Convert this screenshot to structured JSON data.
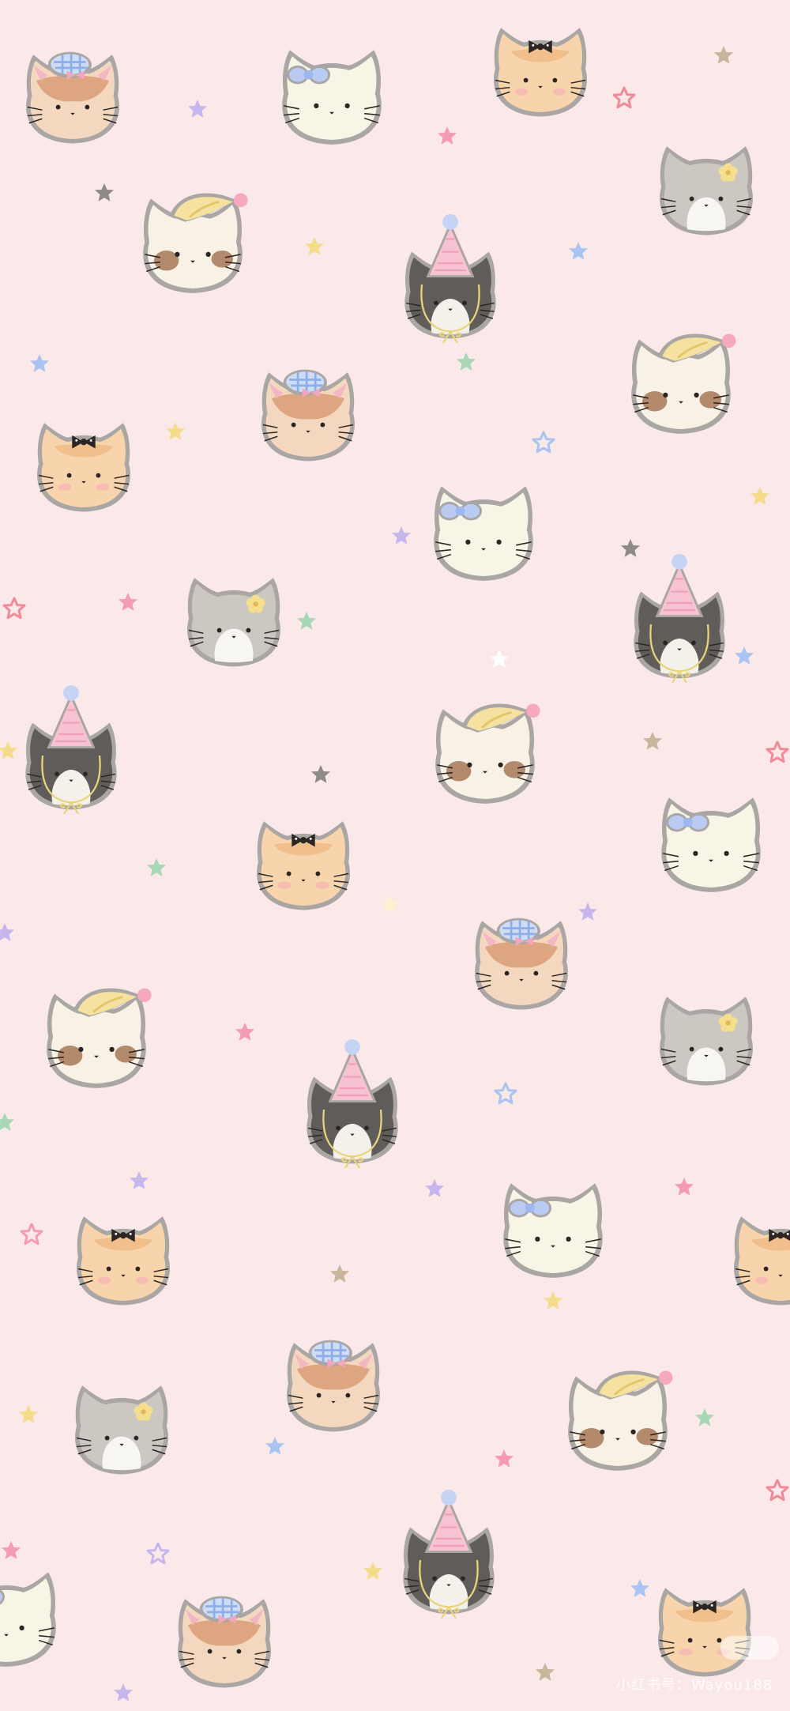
{
  "wallpaper": {
    "background_color": "#fbe9ea",
    "outline_color": "#a9a6a4",
    "star_colors": [
      "#f49bb4",
      "#a9c4f2",
      "#f4dc8a",
      "#c7b6ee",
      "#a7d7b4",
      "#8f8a8a",
      "#c9b49c",
      "#f08a98",
      "#ffffff"
    ],
    "cat_variants": [
      "ginger-cat-gingham-hat",
      "cream-cat-blue-bow",
      "orange-cat-black-bow",
      "grey-cat-yellow-flower",
      "calico-cat-banana-hat",
      "grey-white-cat-party-hat"
    ]
  },
  "watermark": {
    "text": "小红书号：Wayou188"
  }
}
